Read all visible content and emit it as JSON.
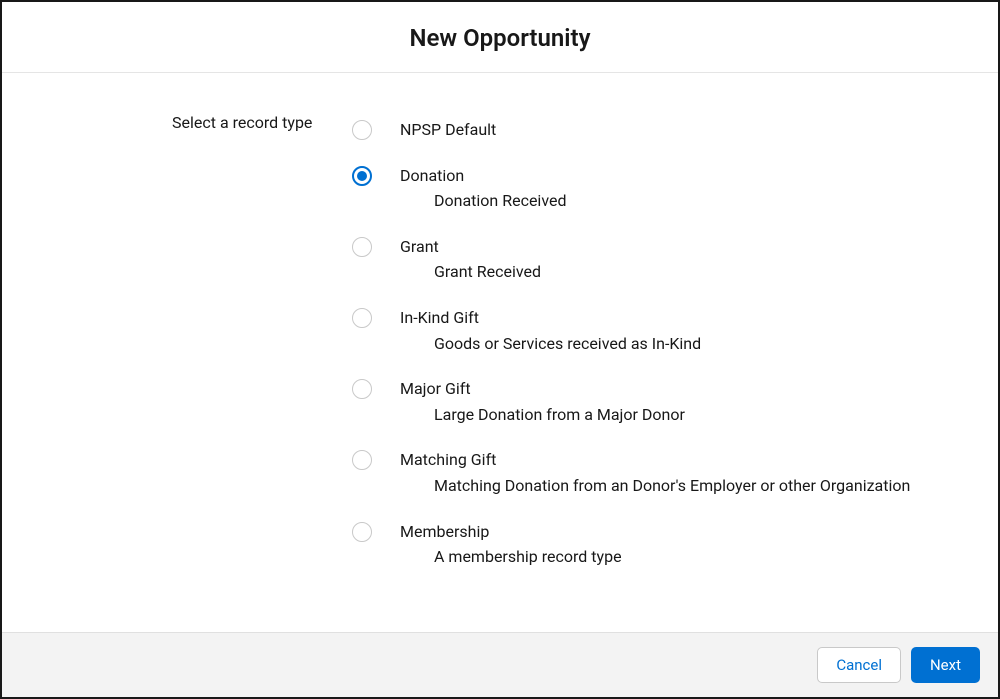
{
  "modal": {
    "title": "New Opportunity",
    "field_label": "Select a record type",
    "selected_index": 1,
    "options": [
      {
        "label": "NPSP Default",
        "description": ""
      },
      {
        "label": "Donation",
        "description": "Donation Received"
      },
      {
        "label": "Grant",
        "description": "Grant Received"
      },
      {
        "label": "In-Kind Gift",
        "description": "Goods or Services received as In-Kind"
      },
      {
        "label": "Major Gift",
        "description": "Large Donation from a Major Donor"
      },
      {
        "label": "Matching Gift",
        "description": "Matching Donation from an Donor's Employer or other Organization"
      },
      {
        "label": "Membership",
        "description": "A membership record type"
      }
    ],
    "cancel_label": "Cancel",
    "next_label": "Next"
  }
}
